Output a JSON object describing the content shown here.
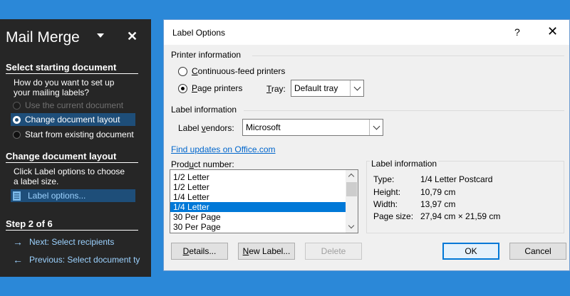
{
  "pane": {
    "title": "Mail Merge",
    "sec1": "Select starting document",
    "q1": "How do you want to set up",
    "q2": "your mailing labels?",
    "opt_current": "Use the current document",
    "opt_change": "Change document layout",
    "opt_existing": "Start from existing document",
    "sec2": "Change document layout",
    "d1": "Click Label options to choose",
    "d2": "a label size.",
    "label_options_link": "Label options...",
    "step": "Step 2 of 6",
    "next": "Next: Select recipients",
    "prev": "Previous: Select document ty"
  },
  "dialog": {
    "title": "Label Options",
    "help": "?",
    "printer_info": "Printer information",
    "continuous_pre": "",
    "continuous_u": "C",
    "continuous_post": "ontinuous-feed printers",
    "page_pre": "",
    "page_u": "P",
    "page_post": "age printers",
    "tray_u": "T",
    "tray_post": "ray:",
    "tray_value": "Default tray",
    "label_info": "Label information",
    "vendors_pre": "Label ",
    "vendors_u": "v",
    "vendors_post": "endors:",
    "vendor_value": "Microsoft",
    "find_updates": "Find updates on Office.com",
    "product_number_pre": "Prod",
    "product_number_u": "u",
    "product_number_post": "ct number:",
    "products": [
      "1/2 Letter",
      "1/2 Letter",
      "1/4 Letter",
      "1/4 Letter",
      "30 Per Page",
      "30 Per Page"
    ],
    "selected_index": 3,
    "info_title": "Label information",
    "info_type_k": "Type:",
    "info_type_v": "1/4 Letter Postcard",
    "info_height_k": "Height:",
    "info_height_v": "10,79 cm",
    "info_width_k": "Width:",
    "info_width_v": "13,97 cm",
    "info_page_k": "Page size:",
    "info_page_v": "27,94 cm × 21,59 cm",
    "details_u": "D",
    "details_post": "etails...",
    "newlabel_u": "N",
    "newlabel_post": "ew Label...",
    "delete": "Delete",
    "ok": "OK",
    "cancel": "Cancel"
  },
  "colors": {
    "accent": "#0078d7",
    "pane_bg": "#262626",
    "pane_selected": "#1e4e79",
    "link": "#0066cc",
    "desktop": "#2b88d8"
  }
}
